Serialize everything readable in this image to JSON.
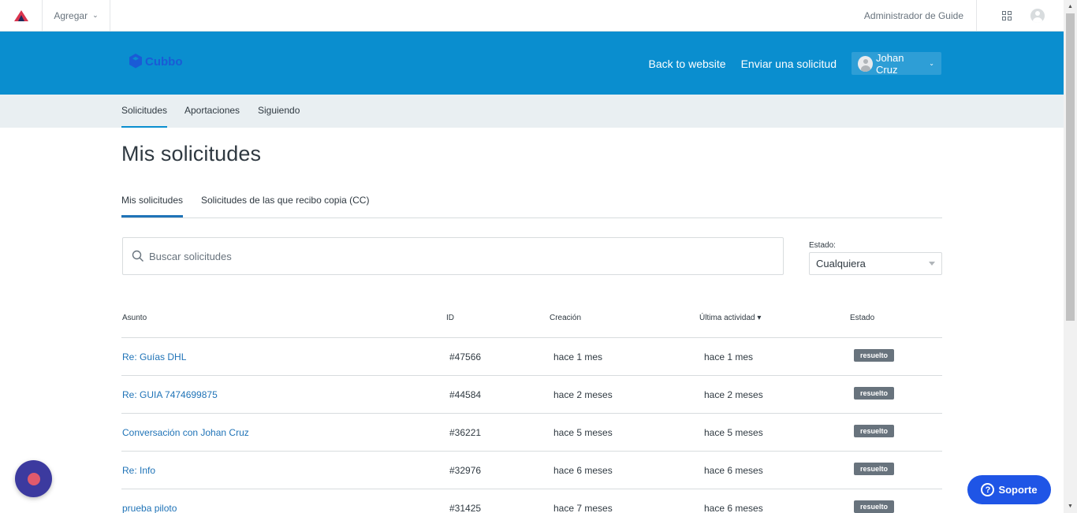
{
  "adminbar": {
    "add_label": "Agregar",
    "admin_link": "Administrador de Guide",
    "icons": [
      "logo-icon",
      "grid-icon",
      "avatar-icon",
      "chevron-down-icon"
    ]
  },
  "header": {
    "brand": "Cubbo",
    "nav": {
      "back": "Back to website",
      "submit": "Enviar una solicitud",
      "user": "Johan Cruz"
    },
    "colors": {
      "header_bg": "#0a8ecf",
      "brand": "#1a5bd6"
    }
  },
  "subnav": {
    "tabs": [
      "Solicitudes",
      "Aportaciones",
      "Siguiendo"
    ],
    "active": "Solicitudes"
  },
  "page_title": "Mis solicitudes",
  "filters": {
    "tabs": [
      "Mis solicitudes",
      "Solicitudes de las que recibo copia (CC)"
    ],
    "active": "Mis solicitudes"
  },
  "search": {
    "placeholder": "Buscar solicitudes"
  },
  "estado": {
    "label": "Estado:",
    "value": "Cualquiera"
  },
  "table": {
    "headers": {
      "subject": "Asunto",
      "id": "ID",
      "created": "Creación",
      "last": "Última actividad ▾",
      "status": "Estado"
    },
    "rows": [
      {
        "subject": "Re: Guías DHL",
        "id": "#47566",
        "created": "hace 1 mes",
        "last": "hace 1 mes",
        "status": "resuelto"
      },
      {
        "subject": "Re: GUIA 7474699875",
        "id": "#44584",
        "created": "hace 2 meses",
        "last": "hace 2 meses",
        "status": "resuelto"
      },
      {
        "subject": "Conversación con Johan Cruz",
        "id": "#36221",
        "created": "hace 5 meses",
        "last": "hace 5 meses",
        "status": "resuelto"
      },
      {
        "subject": "Re: Info",
        "id": "#32976",
        "created": "hace 6 meses",
        "last": "hace 6 meses",
        "status": "resuelto"
      },
      {
        "subject": "prueba piloto",
        "id": "#31425",
        "created": "hace 7 meses",
        "last": "hace 6 meses",
        "status": "resuelto"
      }
    ]
  },
  "widgets": {
    "support_label": "Soporte"
  }
}
